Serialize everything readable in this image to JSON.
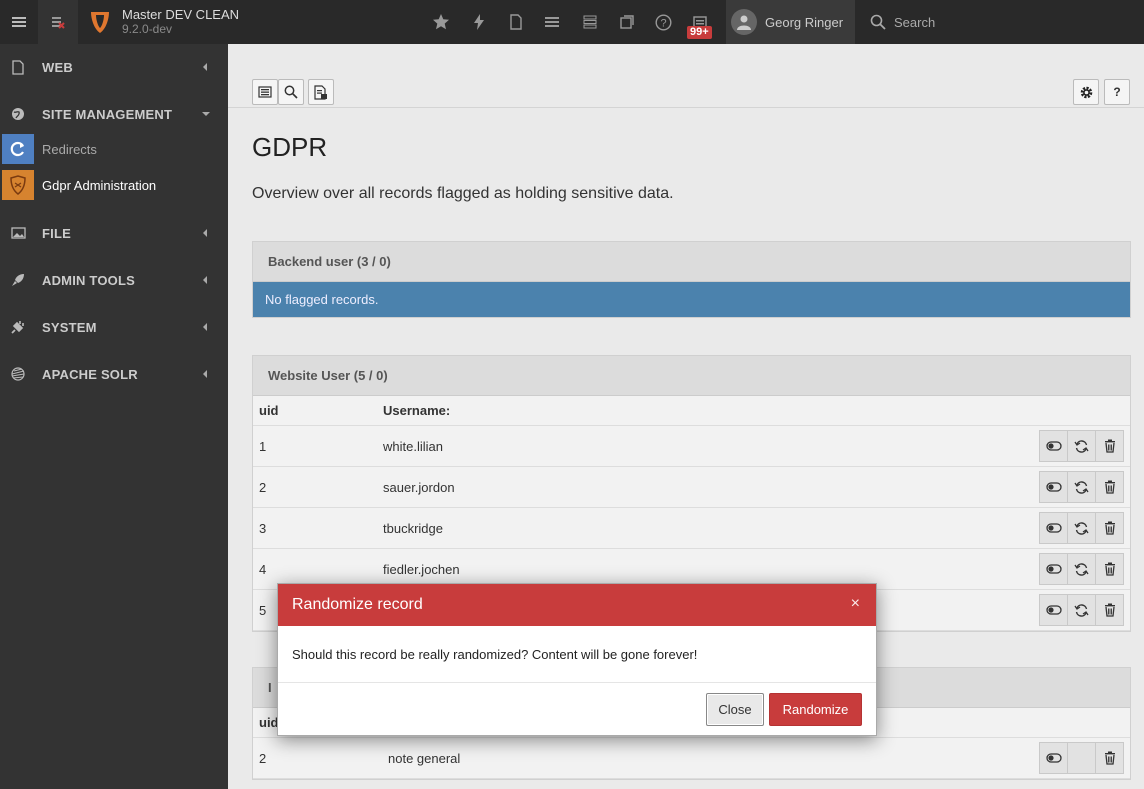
{
  "topbar": {
    "site_name": "Master DEV CLEAN",
    "site_version": "9.2.0-dev",
    "badge": "99+",
    "user_name": "Georg Ringer",
    "search_label": "Search",
    "icons": [
      "bookmark-icon",
      "flash-icon",
      "page-icon",
      "list-icon",
      "server-icon",
      "window-icon",
      "help-icon",
      "notifications-icon"
    ]
  },
  "sidebar": {
    "groups": [
      {
        "label": "WEB",
        "icon": "page-icon"
      },
      {
        "label": "SITE MANAGEMENT",
        "icon": "globe-icon"
      },
      {
        "label": "FILE",
        "icon": "image-icon"
      },
      {
        "label": "ADMIN TOOLS",
        "icon": "rocket-icon"
      },
      {
        "label": "SYSTEM",
        "icon": "plug-icon"
      },
      {
        "label": "APACHE SOLR",
        "icon": "solr-icon"
      }
    ],
    "subitems": [
      {
        "label": "Redirects",
        "color": "#4f80c2"
      },
      {
        "label": "Gdpr Administration",
        "color": "#d6832f"
      }
    ]
  },
  "main": {
    "title": "GDPR",
    "lead": "Overview over all records flagged as holding sensitive data.",
    "panels": {
      "backend": {
        "title": "Backend user (3 / 0)",
        "info": "No flagged records."
      },
      "website": {
        "title": "Website User (5 / 0)",
        "col_uid": "uid",
        "col_user": "Username:",
        "rows": [
          {
            "uid": "1",
            "user": "white.lilian"
          },
          {
            "uid": "2",
            "user": "sauer.jordon"
          },
          {
            "uid": "3",
            "user": "tbuckridge"
          },
          {
            "uid": "4",
            "user": "fiedler.jochen"
          },
          {
            "uid": "5",
            "user": ""
          }
        ]
      },
      "third": {
        "title_partial": "I",
        "col_uid_partial": "uid",
        "row": {
          "uid": "2",
          "user": "note general"
        }
      }
    }
  },
  "modal": {
    "title": "Randomize record",
    "close_x": "×",
    "message": "Should this record be really randomized? Content will be gone forever!",
    "btn_close": "Close",
    "btn_randomize": "Randomize"
  },
  "colors": {
    "topbar": "#292929",
    "sidebar": "#333333",
    "danger": "#c83c3c",
    "info": "#4b82ad"
  }
}
